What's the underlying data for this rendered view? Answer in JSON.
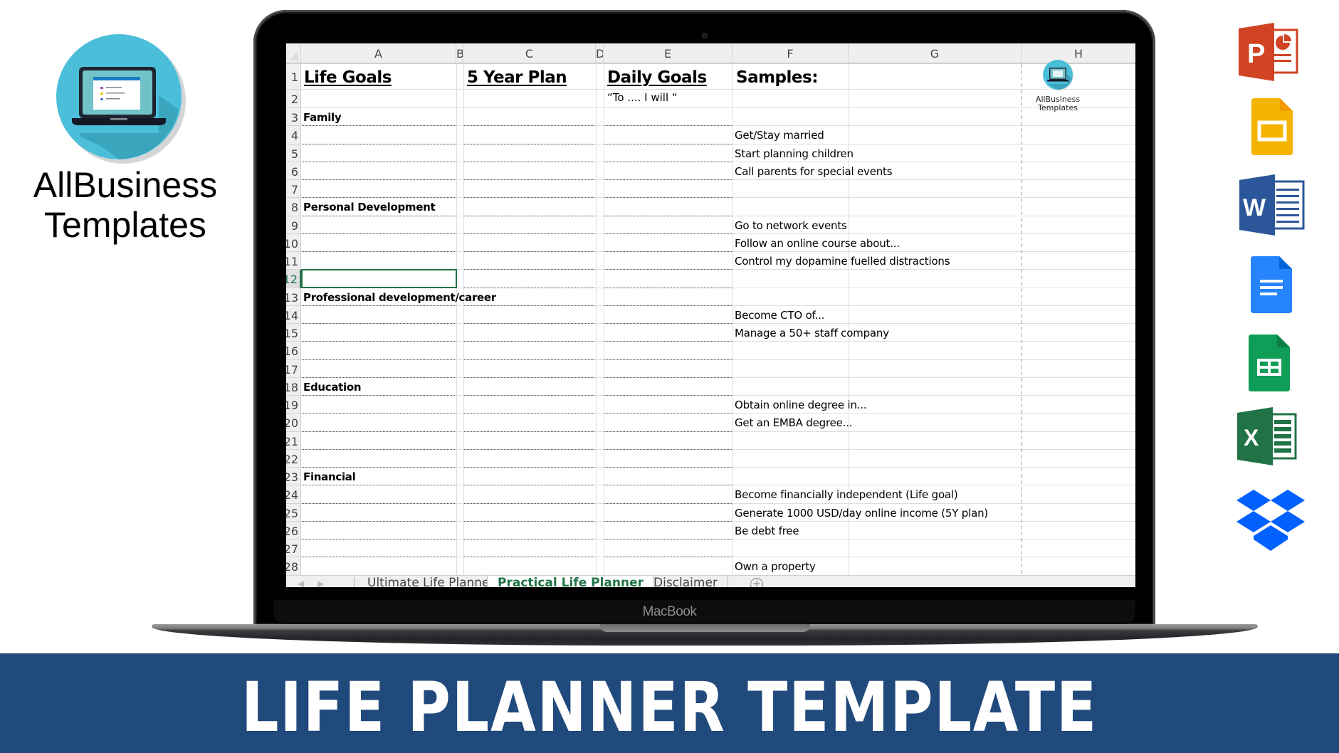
{
  "brand": {
    "name_line1": "AllBusiness",
    "name_line2": "Templates",
    "colors": {
      "circle": "#4bbfda",
      "shadow": "#3aa6bd",
      "laptop": "#1f2430"
    }
  },
  "device": {
    "label": "MacBook"
  },
  "spreadsheet": {
    "columns": [
      "A",
      "B",
      "C",
      "D",
      "E",
      "F",
      "G",
      "H"
    ],
    "rows": [
      "1",
      "2",
      "3",
      "4",
      "5",
      "6",
      "7",
      "8",
      "9",
      "10",
      "11",
      "12",
      "13",
      "14",
      "15",
      "16",
      "17",
      "18",
      "19",
      "20",
      "21",
      "22",
      "23",
      "24",
      "25",
      "26",
      "27",
      "28"
    ],
    "selected_row": "12",
    "selected_cell": "A12",
    "headers": {
      "life_goals": "Life Goals",
      "five_year_plan": "5 Year Plan",
      "daily_goals": "Daily Goals",
      "daily_goals_hint": "“To .... I will “",
      "samples": "Samples:"
    },
    "categories": [
      {
        "row": 3,
        "label": "Family"
      },
      {
        "row": 8,
        "label": "Personal Development"
      },
      {
        "row": 13,
        "label": "Professional development/career"
      },
      {
        "row": 18,
        "label": "Education"
      },
      {
        "row": 23,
        "label": "Financial"
      }
    ],
    "samples": [
      {
        "row": 4,
        "text": "Get/Stay married"
      },
      {
        "row": 5,
        "text": "Start planning children"
      },
      {
        "row": 6,
        "text": "Call parents for special events"
      },
      {
        "row": 9,
        "text": "Go to network events"
      },
      {
        "row": 10,
        "text": "Follow an online course about..."
      },
      {
        "row": 11,
        "text": "Control my dopamine fuelled distractions"
      },
      {
        "row": 14,
        "text": "Become CTO of..."
      },
      {
        "row": 15,
        "text": "Manage a 50+ staff company"
      },
      {
        "row": 19,
        "text": "Obtain online degree in..."
      },
      {
        "row": 20,
        "text": "Get an EMBA degree..."
      },
      {
        "row": 24,
        "text": "Become financially independent (Life goal)"
      },
      {
        "row": 25,
        "text": "Generate 1000 USD/day online income (5Y plan)"
      },
      {
        "row": 26,
        "text": "Be debt free"
      },
      {
        "row": 28,
        "text": "Own a property"
      }
    ],
    "embedded_logo": {
      "line1": "AllBusiness",
      "line2": "Templates"
    },
    "sheet_tabs": [
      {
        "label": "Ultimate Life Planner",
        "active": false
      },
      {
        "label": "Practical Life Planner",
        "active": true
      },
      {
        "label": "Disclaimer",
        "active": false
      }
    ],
    "add_sheet_symbol": "+",
    "accent_color": "#217346"
  },
  "app_icons": [
    {
      "name": "powerpoint-icon",
      "letter": "P",
      "color": "#d04423"
    },
    {
      "name": "google-slides-icon",
      "color": "#f4b400"
    },
    {
      "name": "word-icon",
      "letter": "W",
      "color": "#2b579a"
    },
    {
      "name": "google-docs-icon",
      "color": "#2684fc"
    },
    {
      "name": "google-sheets-icon",
      "color": "#0f9d58"
    },
    {
      "name": "excel-icon",
      "letter": "X",
      "color": "#217346"
    },
    {
      "name": "dropbox-icon",
      "color": "#0061fe"
    }
  ],
  "banner": {
    "title": "LIFE PLANNER TEMPLATE",
    "color": "#214a7c"
  }
}
